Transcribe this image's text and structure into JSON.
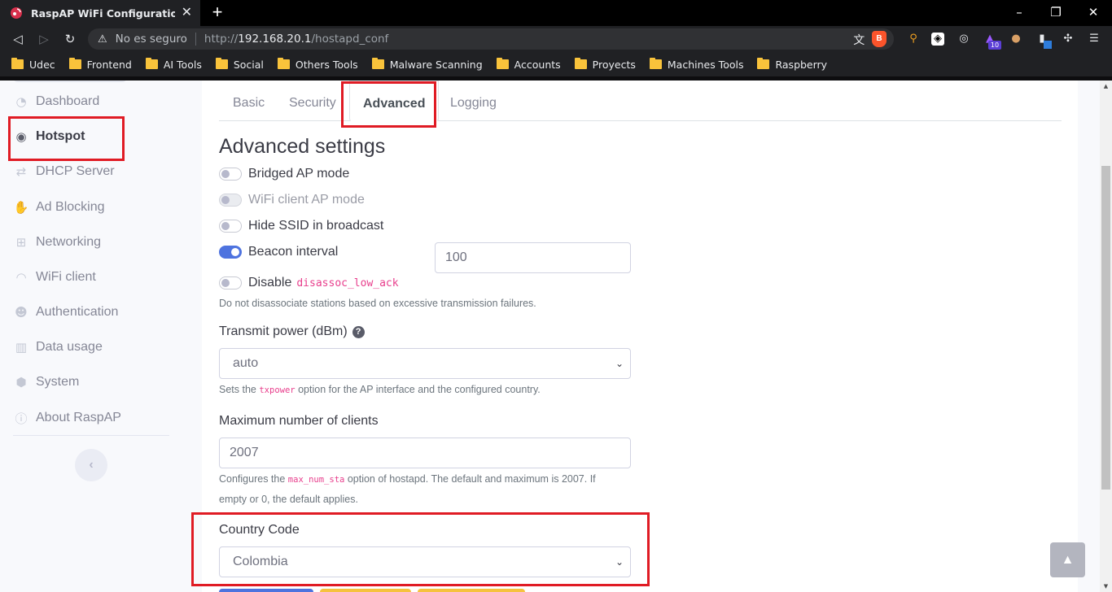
{
  "browser": {
    "tab_title": "RaspAP WiFi Configuration Portal",
    "tab_close": "✕",
    "new_tab": "+",
    "window_controls": {
      "minimize": "–",
      "maximize": "❐",
      "close": "✕"
    },
    "security_label": "No es seguro",
    "url_scheme": "http://",
    "url_host": "192.168.20.1",
    "url_path": "/hostapd_conf",
    "extension_badge": "10",
    "bookmarks": [
      "Udec",
      "Frontend",
      "AI Tools",
      "Social",
      "Others Tools",
      "Malware Scanning",
      "Accounts",
      "Proyects",
      "Machines Tools",
      "Raspberry"
    ]
  },
  "sidebar": {
    "items": [
      {
        "label": "Dashboard",
        "icon": "tachometer-icon",
        "glyph": "◔"
      },
      {
        "label": "Hotspot",
        "icon": "dot-circle-icon",
        "glyph": "◉"
      },
      {
        "label": "DHCP Server",
        "icon": "exchange-icon",
        "glyph": "⇄"
      },
      {
        "label": "Ad Blocking",
        "icon": "hand-icon",
        "glyph": "✋"
      },
      {
        "label": "Networking",
        "icon": "network-icon",
        "glyph": "⊞"
      },
      {
        "label": "WiFi client",
        "icon": "wifi-icon",
        "glyph": "◠"
      },
      {
        "label": "Authentication",
        "icon": "users-icon",
        "glyph": "☻"
      },
      {
        "label": "Data usage",
        "icon": "chart-icon",
        "glyph": "▥"
      },
      {
        "label": "System",
        "icon": "cube-icon",
        "glyph": "⬢"
      },
      {
        "label": "About RaspAP",
        "icon": "info-icon",
        "glyph": "ⓘ"
      }
    ],
    "active": "Hotspot",
    "toggle_glyph": "‹"
  },
  "tabs": [
    "Basic",
    "Security",
    "Advanced",
    "Logging"
  ],
  "active_tab": "Advanced",
  "advanced": {
    "title": "Advanced settings",
    "bridged_ap": {
      "label": "Bridged AP mode",
      "checked": false
    },
    "wifi_client_ap": {
      "label": "WiFi client AP mode",
      "checked": false,
      "disabled": true
    },
    "hide_ssid": {
      "label": "Hide SSID in broadcast",
      "checked": false
    },
    "beacon_interval": {
      "label": "Beacon interval",
      "checked": true,
      "value": "100"
    },
    "disassoc": {
      "label_prefix": "Disable",
      "code": "disassoc_low_ack",
      "checked": false,
      "help": "Do not disassociate stations based on excessive transmission failures."
    },
    "transmit_power": {
      "label": "Transmit power (dBm)",
      "help_glyph": "?",
      "value": "auto",
      "help_prefix": "Sets the",
      "help_code": "txpower",
      "help_suffix": "option for the AP interface and the configured country."
    },
    "max_clients": {
      "label": "Maximum number of clients",
      "value": "2007",
      "help_prefix": "Configures the",
      "help_code": "max_num_sta",
      "help_suffix": "option of hostapd. The default and maximum is 2007. If",
      "help_line2": "empty or 0, the default applies."
    },
    "country_code": {
      "label": "Country Code",
      "value": "Colombia"
    }
  },
  "scroll_top_glyph": "▲",
  "select_arrow": "⌄",
  "colors": {
    "primary": "#4e73df",
    "highlight": "#e01b24",
    "code": "#e83e8c"
  }
}
